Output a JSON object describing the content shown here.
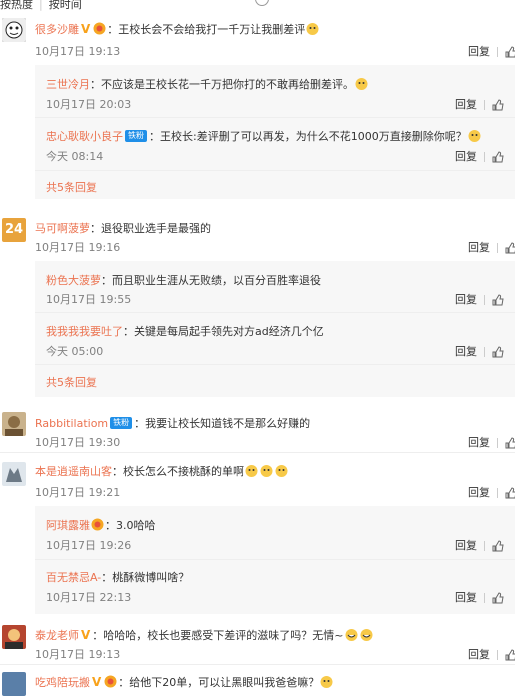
{
  "sort_tabs": {
    "hot": "按热度",
    "time": "按时间"
  },
  "action": {
    "reply": "回复"
  },
  "comments": [
    {
      "user": "很多沙雕",
      "text": "：王校长会不会给我打一千万让我删差评",
      "time": "10月17日 19:13"
    },
    {
      "user": "三世冷月",
      "text": "：不应该是王校长花一千万把你打的不敢再给删差评。",
      "time": "10月17日 20:03"
    },
    {
      "user": "忠心耿耿小良子",
      "badge": "铁粉",
      "text": "：王校长:差评删了可以再发，为什么不花1000万直接删除你呢？",
      "time": "今天 08:14"
    },
    {
      "more": "共5条回复"
    },
    {
      "user": "马可啊菠萝",
      "text": "：退役职业选手是最强的",
      "time": "10月17日 19:16",
      "avatar_text": "24"
    },
    {
      "user": "粉色大菠萝",
      "text": "：而且职业生涯从无败绩，以百分百胜率退役",
      "time": "10月17日 19:55"
    },
    {
      "user": "我我我我要吐了",
      "text": "：关键是每局起手领先对方ad经济几个亿",
      "time": "今天 05:00"
    },
    {
      "more": "共5条回复"
    },
    {
      "user": "Rabbitilatiom",
      "badge": "铁粉",
      "text": "：我要让校长知道钱不是那么好赚的",
      "time": "10月17日 19:30"
    },
    {
      "user": "本是逍遥南山客",
      "text": "：校长怎么不接桃酥的单啊",
      "time": "10月17日 19:21"
    },
    {
      "user": "阿琪露雅",
      "text": "：3.0哈哈",
      "time": "10月17日 19:26"
    },
    {
      "user": "百无禁忌A-",
      "text": "：桃酥微博叫啥？",
      "time": "10月17日 22:13"
    },
    {
      "user": "泰龙老师",
      "text": "：哈哈哈，校长也要感受下差评的滋味了吗？无情~",
      "time": "10月17日 19:13"
    },
    {
      "user": "吃鸡陪玩搬",
      "text": "：给他下20单，可以让黑眼叫我爸爸嘛？",
      "time": ""
    }
  ],
  "colors": {
    "username": "#eb7350",
    "subbg": "#f7f7f7",
    "vip": "#f8a21b",
    "fan_badge": "#1f8fe8"
  }
}
